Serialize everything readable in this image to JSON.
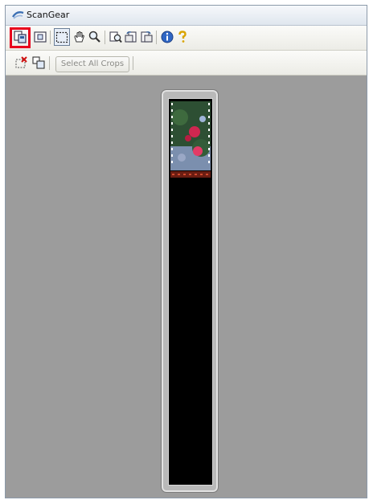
{
  "window": {
    "title": "ScanGear"
  },
  "toolbar": {
    "buttons": [
      {
        "name": "thumbnail-view-button",
        "icon": "thumbnail-icon",
        "highlighted": true
      },
      {
        "name": "whole-image-view-button",
        "icon": "whole-image-icon"
      },
      {
        "name": "crop-button",
        "icon": "crop-icon",
        "pressed": true
      },
      {
        "name": "move-image-button",
        "icon": "move-hand-icon"
      },
      {
        "name": "zoom-button",
        "icon": "magnifier-icon"
      },
      {
        "name": "scan-button",
        "icon": "scan-icon"
      },
      {
        "name": "rotate-left-button",
        "icon": "rotate-left-icon"
      },
      {
        "name": "rotate-right-button",
        "icon": "rotate-right-icon"
      },
      {
        "name": "information-button",
        "icon": "info-icon"
      },
      {
        "name": "help-button",
        "icon": "help-question-icon"
      }
    ],
    "highlight_color": "#e8001c"
  },
  "crop_toolbar": {
    "select_all_label": "Select All Crops",
    "select_all_enabled": false
  },
  "preview": {
    "background": "#9c9c9c",
    "film_base": "#000000"
  }
}
